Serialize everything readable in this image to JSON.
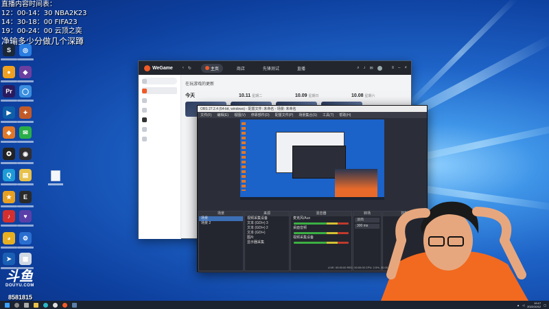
{
  "stream_overlay": {
    "line1": "直播内容时间表：",
    "line2": "12：00-14：30 NBA2K23",
    "line3": "14：30-18：00 FIFA23",
    "line4": "19：00-24：00 云顶之奕",
    "line5": "净输多少分做几个深蹲"
  },
  "desktop_icons": [
    {
      "name": "steam-icon",
      "color": "#1b2838",
      "glyph": "S"
    },
    {
      "name": "browser-icon",
      "color": "#2a7de1",
      "glyph": "◎"
    },
    {
      "name": "app-icon",
      "color": "#f0a020",
      "glyph": "●"
    },
    {
      "name": "game-icon",
      "color": "#6b3fa0",
      "glyph": "◆"
    },
    {
      "name": "premiere-icon",
      "color": "#2a1a5e",
      "glyph": "Pr"
    },
    {
      "name": "search-app-icon",
      "color": "#3b8fe0",
      "glyph": "◯"
    },
    {
      "name": "media-icon",
      "color": "#0e5fa8",
      "glyph": "▶"
    },
    {
      "name": "tool-icon",
      "color": "#c25a28",
      "glyph": "✦"
    },
    {
      "name": "orange-app-icon",
      "color": "#e07828",
      "glyph": "◆"
    },
    {
      "name": "wechat-icon",
      "color": "#2aae48",
      "glyph": "✉"
    },
    {
      "name": "game2-icon",
      "color": "#222",
      "glyph": "✪"
    },
    {
      "name": "obs-icon",
      "color": "#302e31",
      "glyph": "◉"
    },
    {
      "name": "qq-icon",
      "color": "#1e9bd7",
      "glyph": "Q"
    },
    {
      "name": "folder-icon",
      "color": "#e8c14a",
      "glyph": "▤"
    },
    {
      "name": "yellow-app-icon",
      "color": "#e8a020",
      "glyph": "★"
    },
    {
      "name": "epic-icon",
      "color": "#2a2a2a",
      "glyph": "E"
    },
    {
      "name": "netease-icon",
      "color": "#d32f2f",
      "glyph": "♪"
    },
    {
      "name": "purple-app-icon",
      "color": "#5b3fa8",
      "glyph": "♥"
    },
    {
      "name": "chrome-icon",
      "color": "#e8b020",
      "glyph": "◕"
    },
    {
      "name": "gear-app-icon",
      "color": "#2a6fd0",
      "glyph": "⚙"
    },
    {
      "name": "arrow-app-icon",
      "color": "#1a5fb4",
      "glyph": "➤"
    },
    {
      "name": "doc-app-icon",
      "color": "#cfd8e3",
      "glyph": "▦"
    }
  ],
  "wegame": {
    "logo": "WeGame",
    "tabs": [
      "主页",
      "商店",
      "先锋测试",
      "直播"
    ],
    "section_title": "在玩游戏的更新",
    "dates": [
      {
        "day": "今天",
        "sub": ""
      },
      {
        "day": "10.11",
        "sub": "星期二"
      },
      {
        "day": "10.09",
        "sub": "星期日"
      },
      {
        "day": "10.08",
        "sub": "星期六"
      }
    ]
  },
  "obs": {
    "title": "OBS 27.2.4 (64-bit, windows) - 配置文件: 未命名 - 场景: 未命名",
    "menu": [
      "文件(F)",
      "编辑(E)",
      "视图(V)",
      "停靠部件(D)",
      "配置文件(P)",
      "场景集合(S)",
      "工具(T)",
      "帮助(H)"
    ],
    "panels": {
      "scenes": "场景",
      "sources": "来源",
      "mixer": "混音器",
      "transitions": "转场",
      "controls": "控制"
    },
    "scene_items": [
      "场景",
      "场景 2"
    ],
    "source_items": [
      "视频采集设备",
      "文本 (GDI+) 3",
      "文本 (GDI+) 2",
      "文本 (GDI+)",
      "图片",
      "显示器采集"
    ],
    "mixer_items": [
      "麦克风/Aux",
      "桌面音频",
      "视频采集设备"
    ],
    "transition_value": "淡出",
    "duration_label": "300 ms",
    "status": "LIVE: 00:00:00  REC: 00:00:00  CPU: 2.5%, 30.00 fps"
  },
  "douyu": {
    "logo": "斗鱼",
    "sub": "DOUYU.COM",
    "viewer_count": "8581815"
  },
  "taskbar": {
    "time": "19:17",
    "date": "2022/10/12"
  }
}
